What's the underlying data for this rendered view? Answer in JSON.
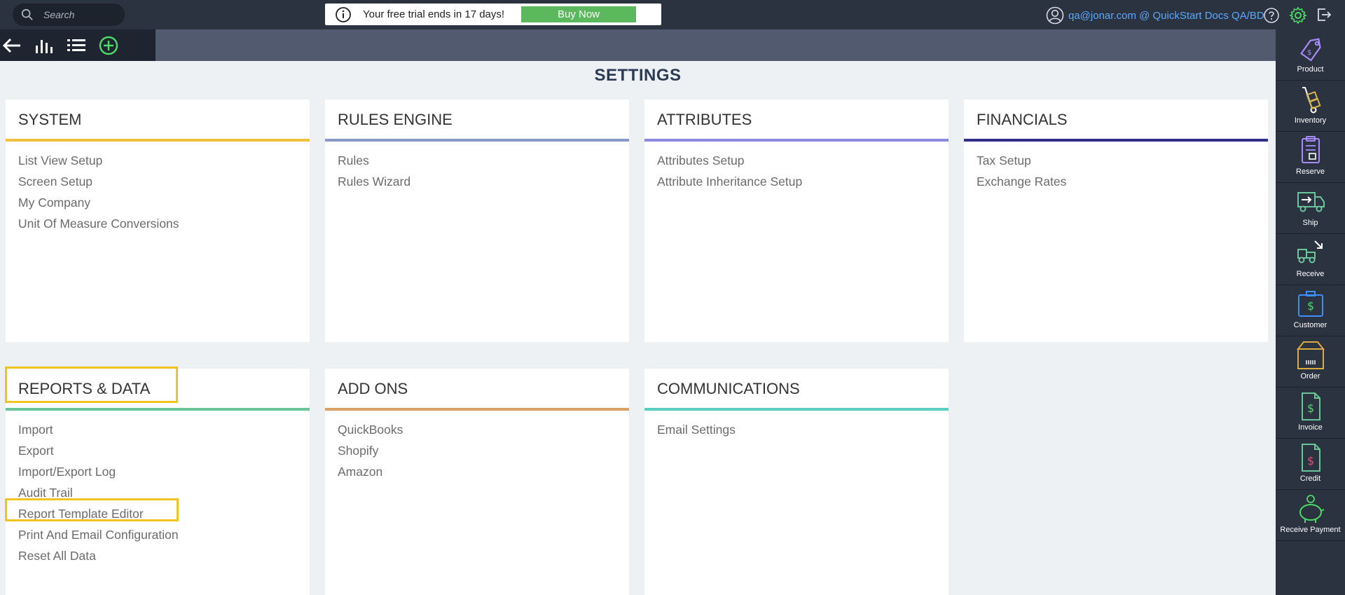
{
  "topbar": {
    "search_placeholder": "Search",
    "trial_message": "Your free trial ends in 17 days!",
    "buy_label": "Buy Now",
    "user_label": "qa@jonar.com @ QuickStart Docs QA/BD"
  },
  "page": {
    "title": "SETTINGS"
  },
  "colors": {
    "system": "#f0c040",
    "rules_engine": "#8a98c8",
    "attributes": "#8a8adf",
    "financials": "#2e2f88",
    "reports": "#6cc59a",
    "addons": "#d8a064",
    "communications": "#5ccfbf"
  },
  "sections": {
    "system": {
      "title": "SYSTEM",
      "items": [
        "List View Setup",
        "Screen Setup",
        "My Company",
        "Unit Of Measure Conversions"
      ]
    },
    "rules_engine": {
      "title": "RULES ENGINE",
      "items": [
        "Rules",
        "Rules Wizard"
      ]
    },
    "attributes": {
      "title": "ATTRIBUTES",
      "items": [
        "Attributes Setup",
        "Attribute Inheritance Setup"
      ]
    },
    "financials": {
      "title": "FINANCIALS",
      "items": [
        "Tax Setup",
        "Exchange Rates"
      ]
    },
    "reports": {
      "title": "REPORTS & DATA",
      "items": [
        "Import",
        "Export",
        "Import/Export Log",
        "Audit Trail",
        "Report Template Editor",
        "Print And Email Configuration",
        "Reset All Data"
      ]
    },
    "addons": {
      "title": "ADD ONS",
      "items": [
        "QuickBooks",
        "Shopify",
        "Amazon"
      ]
    },
    "communications": {
      "title": "COMMUNICATIONS",
      "items": [
        "Email Settings"
      ]
    }
  },
  "sidebar": {
    "items": [
      {
        "label": "Product",
        "icon": "product-tag-icon"
      },
      {
        "label": "Inventory",
        "icon": "hand-truck-icon"
      },
      {
        "label": "Reserve",
        "icon": "clipboard-icon"
      },
      {
        "label": "Ship",
        "icon": "ship-truck-icon"
      },
      {
        "label": "Receive",
        "icon": "receive-truck-icon"
      },
      {
        "label": "Customer",
        "icon": "briefcase-dollar-icon"
      },
      {
        "label": "Order",
        "icon": "box-icon"
      },
      {
        "label": "Invoice",
        "icon": "invoice-icon"
      },
      {
        "label": "Credit",
        "icon": "credit-icon"
      },
      {
        "label": "Receive Payment",
        "icon": "piggy-bank-icon"
      }
    ]
  }
}
